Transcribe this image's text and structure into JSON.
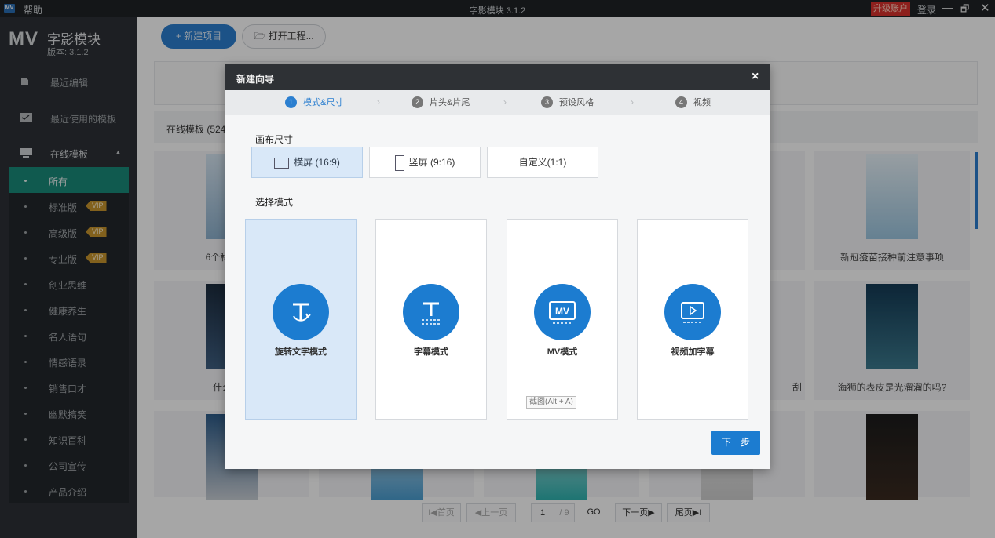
{
  "titlebar": {
    "logo": "MV",
    "help": "帮助",
    "title": "字影模块 3.1.2",
    "upgrade": "升级账户",
    "login": "登录",
    "min_icon": "—",
    "max_icon": "🗗",
    "close_icon": "✕"
  },
  "sidebar": {
    "brand": "MV",
    "app_name": "字影模块",
    "version": "版本: 3.1.2",
    "nav": {
      "recent_edit": "最近编辑",
      "recent_templates": "最近使用的模板",
      "online_templates": "在线模板"
    },
    "categories": [
      {
        "label": "所有",
        "vip": ""
      },
      {
        "label": "标准版",
        "vip": "VIP"
      },
      {
        "label": "高级版",
        "vip": "VIP"
      },
      {
        "label": "专业版",
        "vip": "VIP"
      },
      {
        "label": "创业思维",
        "vip": ""
      },
      {
        "label": "健康养生",
        "vip": ""
      },
      {
        "label": "名人语句",
        "vip": ""
      },
      {
        "label": "情感语录",
        "vip": ""
      },
      {
        "label": "销售口才",
        "vip": ""
      },
      {
        "label": "幽默搞笑",
        "vip": ""
      },
      {
        "label": "知识百科",
        "vip": ""
      },
      {
        "label": "公司宣传",
        "vip": ""
      },
      {
        "label": "产品介绍",
        "vip": ""
      }
    ]
  },
  "main": {
    "new_project": "+  新建项目",
    "open_project": "打开工程...",
    "online_tab": "在线模板 (524",
    "cards": [
      {
        "caption": "6个科室的医"
      },
      {
        "caption": ""
      },
      {
        "caption": ""
      },
      {
        "caption": ""
      },
      {
        "caption": "新冠疫苗接种前注意事项"
      },
      {
        "caption": "什么是到"
      },
      {
        "caption": ""
      },
      {
        "caption": ""
      },
      {
        "caption": "刮"
      },
      {
        "caption": "海狮的表皮是光溜溜的吗?"
      },
      {
        "caption": ""
      },
      {
        "caption": ""
      },
      {
        "caption": ""
      },
      {
        "caption": ""
      },
      {
        "caption": ""
      }
    ],
    "pager": {
      "first": "I◀首页",
      "prev": "◀上一页",
      "current": "1",
      "total": "/ 9",
      "go": "GO",
      "next": "下一页▶",
      "last": "尾页▶I"
    }
  },
  "dialog": {
    "title": "新建向导",
    "close_icon": "×",
    "steps": [
      {
        "num": "1",
        "label": "模式&尺寸"
      },
      {
        "num": "2",
        "label": "片头&片尾"
      },
      {
        "num": "3",
        "label": "预设风格"
      },
      {
        "num": "4",
        "label": "视频"
      }
    ],
    "canvas_label": "画布尺寸",
    "sizes": [
      {
        "label": "横屏 (16:9)"
      },
      {
        "label": "竖屏 (9:16)"
      },
      {
        "label": "自定义(1:1)"
      }
    ],
    "mode_label": "选择模式",
    "modes": [
      {
        "label": "旋转文字模式",
        "icon": "T"
      },
      {
        "label": "字幕模式",
        "icon": "T"
      },
      {
        "label": "MV模式",
        "icon": "MV"
      },
      {
        "label": "视频加字幕",
        "icon": "▷"
      }
    ],
    "tooltip": "截图(Alt + A)",
    "next": "下一步"
  }
}
